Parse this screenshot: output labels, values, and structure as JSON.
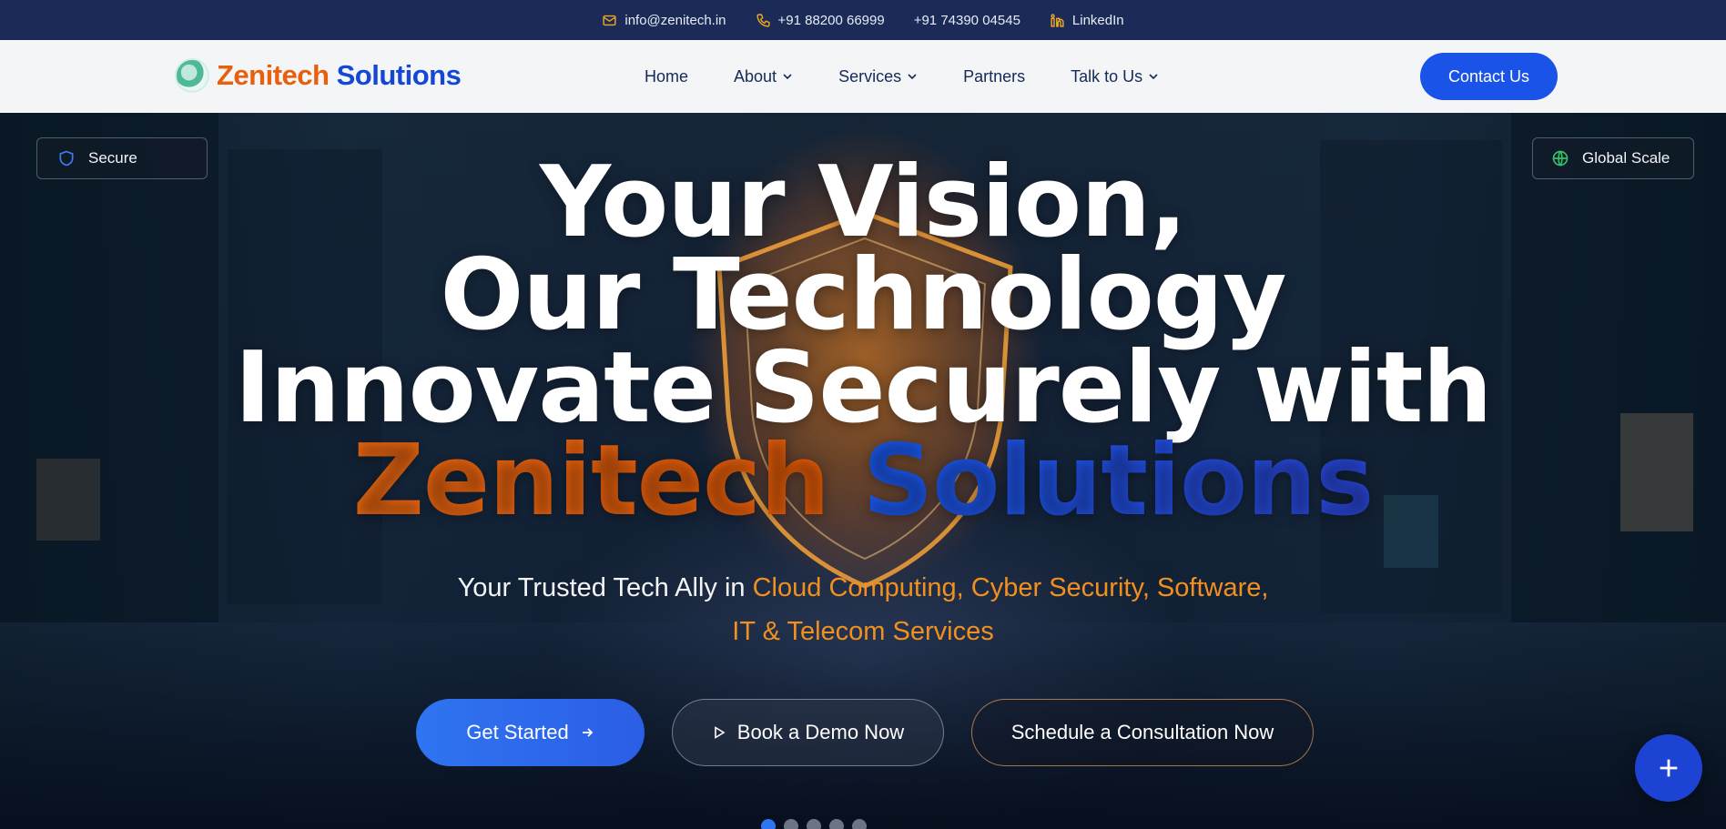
{
  "topbar": {
    "email": "info@zenitech.in",
    "phone1": "+91 88200 66999",
    "phone2": "+91 74390 04545",
    "linkedin": "LinkedIn"
  },
  "brand": {
    "name_part1": "Zenitech",
    "name_part2": "Solutions",
    "colors": {
      "orange": "#e8600d",
      "blue": "#1547d6"
    }
  },
  "nav": {
    "items": [
      {
        "label": "Home",
        "dropdown": false
      },
      {
        "label": "About",
        "dropdown": true
      },
      {
        "label": "Services",
        "dropdown": true
      },
      {
        "label": "Partners",
        "dropdown": false
      },
      {
        "label": "Talk to Us",
        "dropdown": true
      }
    ],
    "contact_label": "Contact Us"
  },
  "hero": {
    "badge_left": "Secure",
    "badge_right": "Global Scale",
    "headline_line1": "Your Vision,",
    "headline_line2": "Our Technology",
    "headline_line3": "Innovate Securely with",
    "headline_brand1": "Zenitech",
    "headline_brand2": "Solutions",
    "subtitle_plain": "Your Trusted Tech Ally in",
    "subtitle_highlight1": "Cloud Computing, Cyber Security, Software,",
    "subtitle_highlight2": "IT & Telecom Services",
    "cta_primary": "Get Started",
    "cta_demo": "Book a Demo Now",
    "cta_consult": "Schedule a Consultation Now",
    "slides_total": 5,
    "slide_active": 1
  },
  "icons": {
    "email": "mail-icon",
    "phone": "phone-icon",
    "linkedin": "linkedin-icon",
    "secure": "shield-icon",
    "global": "globe-icon",
    "fab": "plus-icon"
  }
}
